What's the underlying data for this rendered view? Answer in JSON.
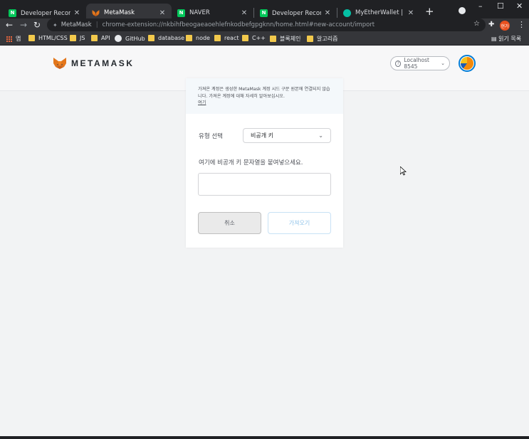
{
  "browser": {
    "tabs": [
      {
        "label": "Developer Record : 네이",
        "favicon": "N",
        "favicon_color": "#03c75a",
        "active": false
      },
      {
        "label": "MetaMask",
        "favicon": "",
        "favicon_color": "#e2761b",
        "active": true
      },
      {
        "label": "NAVER",
        "favicon": "N",
        "favicon_color": "#03c75a",
        "active": false
      },
      {
        "label": "Developer Record : 네이",
        "favicon": "N",
        "favicon_color": "#03c75a",
        "active": false
      },
      {
        "label": "MyEtherWallet | MEW",
        "favicon": "",
        "favicon_color": "#05c0a5",
        "active": false
      }
    ],
    "new_tab": "+",
    "window_controls": {
      "minimize": "–",
      "maximize": "☐",
      "close": "✕"
    },
    "address_bar": {
      "site_label": "MetaMask",
      "url": "chrome-extension://nkbihfbeogaeaoehlefnkodbefgpgknn/home.html#new-account/import"
    },
    "profile_avatar": "현가",
    "bookmarks": [
      {
        "label": "앱",
        "type": "apps"
      },
      {
        "label": "HTML/CSS",
        "type": "folder"
      },
      {
        "label": "JS",
        "type": "folder"
      },
      {
        "label": "API",
        "type": "folder"
      },
      {
        "label": "GitHub",
        "type": "github"
      },
      {
        "label": "database",
        "type": "folder"
      },
      {
        "label": "node",
        "type": "folder"
      },
      {
        "label": "react",
        "type": "folder"
      },
      {
        "label": "C++",
        "type": "folder"
      },
      {
        "label": "블록체인",
        "type": "folder"
      },
      {
        "label": "알고리즘",
        "type": "folder"
      }
    ],
    "reading_list": "읽기 목록"
  },
  "metamask": {
    "wordmark": "METAMASK",
    "network": "Localhost 8545",
    "notice_text": "가져온 계정은 생성한 MetaMask 계정 시드 구문 원본에 연결되지 않습니다. 가져온 계정에 대해 자세히 알아보십시오.",
    "notice_link": "여기",
    "select_label": "유형 선택",
    "select_value": "비공개 키",
    "paste_label": "여기에 비공개 키 문자열을 붙여넣으세요.",
    "key_input_value": "",
    "cancel_label": "취소",
    "import_label": "가져오기"
  },
  "colors": {
    "accent": "#037dd6",
    "fox_orange": "#e2761b"
  }
}
